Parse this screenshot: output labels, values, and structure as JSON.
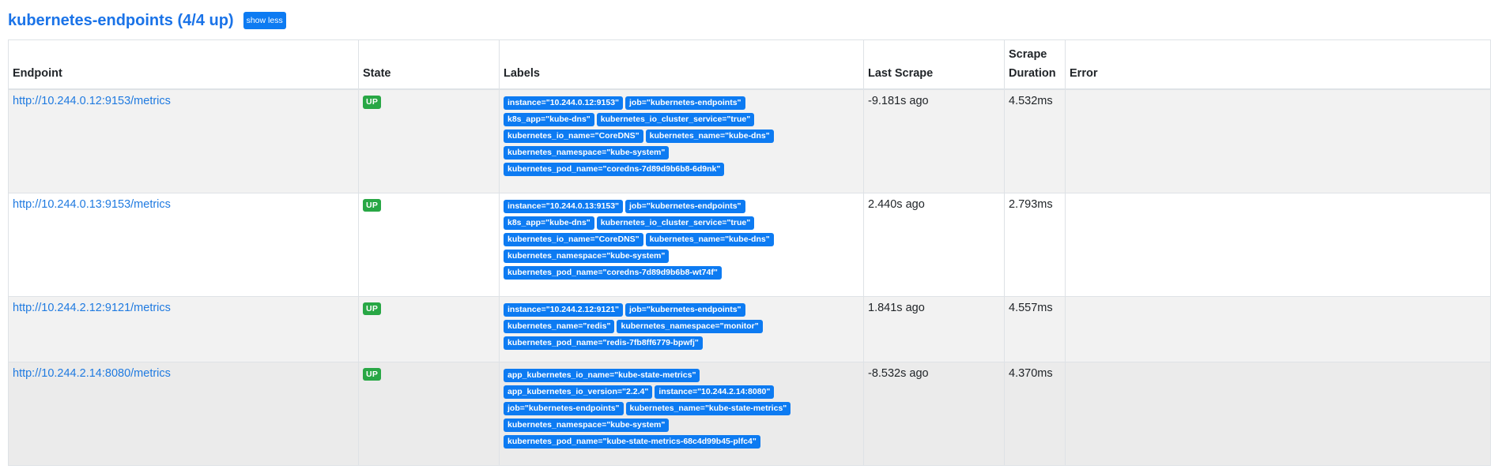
{
  "section": {
    "title": "kubernetes-endpoints (4/4 up)",
    "toggle_label": "show less"
  },
  "table": {
    "headers": {
      "endpoint": "Endpoint",
      "state": "State",
      "labels": "Labels",
      "last_scrape": "Last Scrape",
      "scrape_duration_line1": "Scrape",
      "scrape_duration_line2": "Duration",
      "error": "Error"
    },
    "rows": [
      {
        "endpoint": "http://10.244.0.12:9153/metrics",
        "state": "UP",
        "labels": [
          "instance=\"10.244.0.12:9153\"",
          "job=\"kubernetes-endpoints\"",
          "k8s_app=\"kube-dns\"",
          "kubernetes_io_cluster_service=\"true\"",
          "kubernetes_io_name=\"CoreDNS\"",
          "kubernetes_name=\"kube-dns\"",
          "kubernetes_namespace=\"kube-system\"",
          "kubernetes_pod_name=\"coredns-7d89d9b6b8-6d9nk\""
        ],
        "last_scrape": "-9.181s ago",
        "scrape_duration": "4.532ms",
        "error": ""
      },
      {
        "endpoint": "http://10.244.0.13:9153/metrics",
        "state": "UP",
        "labels": [
          "instance=\"10.244.0.13:9153\"",
          "job=\"kubernetes-endpoints\"",
          "k8s_app=\"kube-dns\"",
          "kubernetes_io_cluster_service=\"true\"",
          "kubernetes_io_name=\"CoreDNS\"",
          "kubernetes_name=\"kube-dns\"",
          "kubernetes_namespace=\"kube-system\"",
          "kubernetes_pod_name=\"coredns-7d89d9b6b8-wt74f\""
        ],
        "last_scrape": "2.440s ago",
        "scrape_duration": "2.793ms",
        "error": ""
      },
      {
        "endpoint": "http://10.244.2.12:9121/metrics",
        "state": "UP",
        "labels": [
          "instance=\"10.244.2.12:9121\"",
          "job=\"kubernetes-endpoints\"",
          "kubernetes_name=\"redis\"",
          "kubernetes_namespace=\"monitor\"",
          "kubernetes_pod_name=\"redis-7fb8ff6779-bpwfj\""
        ],
        "last_scrape": "1.841s ago",
        "scrape_duration": "4.557ms",
        "error": ""
      },
      {
        "endpoint": "http://10.244.2.14:8080/metrics",
        "state": "UP",
        "labels": [
          "app_kubernetes_io_name=\"kube-state-metrics\"",
          "app_kubernetes_io_version=\"2.2.4\"",
          "instance=\"10.244.2.14:8080\"",
          "job=\"kubernetes-endpoints\"",
          "kubernetes_name=\"kube-state-metrics\"",
          "kubernetes_namespace=\"kube-system\"",
          "kubernetes_pod_name=\"kube-state-metrics-68c4d99b45-plfc4\""
        ],
        "last_scrape": "-8.532s ago",
        "scrape_duration": "4.370ms",
        "error": ""
      }
    ]
  },
  "colors": {
    "title": "#1a73e8",
    "badge_blue": "#0d7bf2",
    "badge_green": "#28a745"
  }
}
